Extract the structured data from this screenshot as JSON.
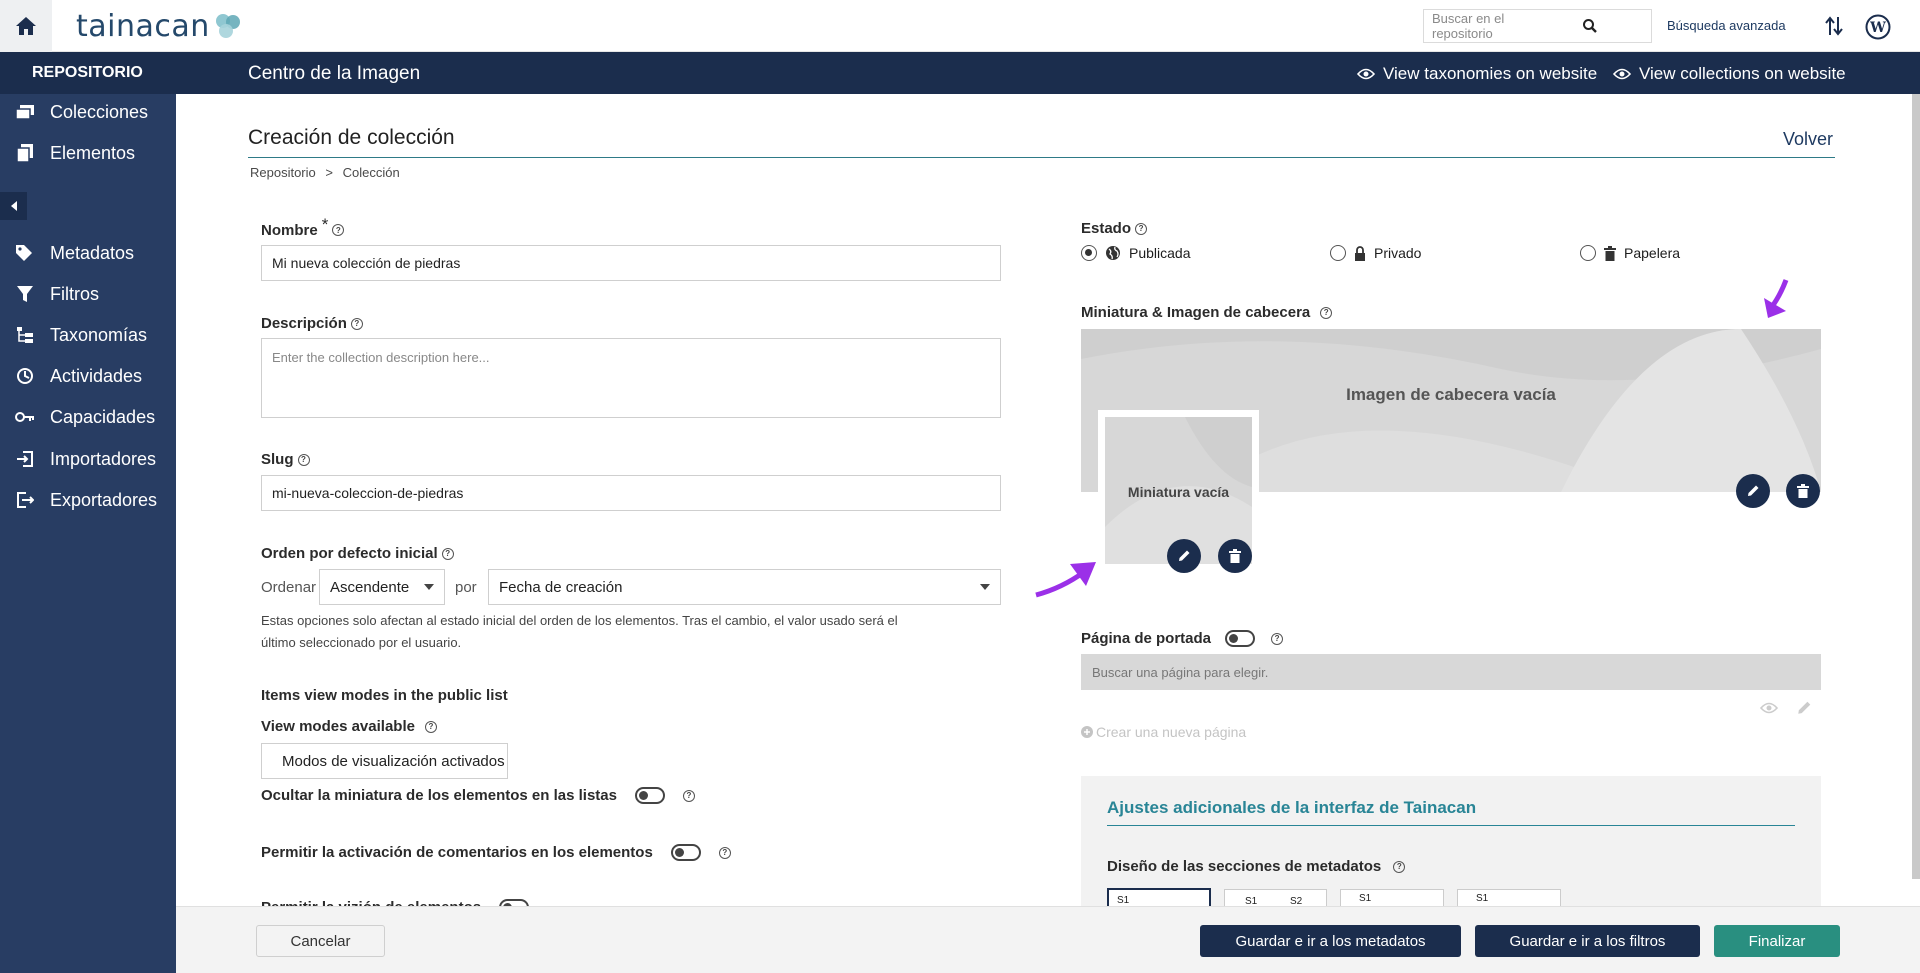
{
  "app": {
    "logo_text": "tainacan"
  },
  "topbar": {
    "search_placeholder": "Buscar en el repositorio",
    "advanced_search": "Búsqueda avanzada"
  },
  "sidebar": {
    "title": "REPOSITORIO",
    "items": [
      {
        "label": "Colecciones",
        "icon": "collections-icon"
      },
      {
        "label": "Elementos",
        "icon": "items-icon"
      },
      {
        "label": "Metadatos",
        "icon": "tag-icon"
      },
      {
        "label": "Filtros",
        "icon": "filter-icon"
      },
      {
        "label": "Taxonomías",
        "icon": "taxonomy-icon"
      },
      {
        "label": "Actividades",
        "icon": "activities-icon"
      },
      {
        "label": "Capacidades",
        "icon": "key-icon"
      },
      {
        "label": "Importadores",
        "icon": "import-icon"
      },
      {
        "label": "Exportadores",
        "icon": "export-icon"
      }
    ]
  },
  "header": {
    "repo_name": "Centro de la Imagen",
    "view_taxonomies": "View taxonomies on website",
    "view_collections": "View collections on website"
  },
  "page": {
    "title": "Creación de colección",
    "back": "Volver",
    "breadcrumb": {
      "root": "Repositorio",
      "sep": ">",
      "current": "Colección"
    }
  },
  "form": {
    "name_label": "Nombre",
    "name_required": "*",
    "name_value": "Mi nueva colección de piedras",
    "description_label": "Descripción",
    "description_placeholder": "Enter the collection description here...",
    "slug_label": "Slug",
    "slug_value": "mi-nueva-coleccion-de-piedras",
    "order_label": "Orden por defecto inicial",
    "order_prefix": "Ordenar",
    "order_value": "Ascendente",
    "order_by": "por",
    "order_field": "Fecha de creación",
    "order_note_1": "Estas opciones solo afectan al estado inicial del orden de los elementos. Tras el cambio, el valor usado será el",
    "order_note_2": "último seleccionado por el usuario.",
    "view_modes_section": "Items view modes in the public list",
    "view_modes_label": "View modes available",
    "view_modes_value": "Modos de visualización activados",
    "hide_thumbnail_label": "Ocultar la miniatura de los elementos en las listas",
    "comments_label": "Permitir la activación de comentarios en los elementos",
    "cut_label": "Permitir la vizión de elementos"
  },
  "status": {
    "label": "Estado",
    "options": [
      "Publicada",
      "Privado",
      "Papelera"
    ],
    "selected": "Publicada"
  },
  "images": {
    "label": "Miniatura & Imagen de cabecera",
    "header_empty": "Imagen de cabecera vacía",
    "thumbnail_empty": "Miniatura vacía"
  },
  "cover_page": {
    "label": "Página de portada",
    "search_placeholder": "Buscar una página para elegir.",
    "create_link": "Crear una nueva página"
  },
  "extra_settings": {
    "title": "Ajustes adicionales de la interfaz de Tainacan",
    "sections_design_label": "Diseño de las secciones de metadatos",
    "layout_options": [
      "S1",
      "S1 S2",
      "S1",
      "S1"
    ]
  },
  "footer": {
    "cancel": "Cancelar",
    "save_metadata": "Guardar e ir a los metadatos",
    "save_filters": "Guardar e ir a los filtros",
    "finish": "Finalizar"
  },
  "colors": {
    "navy": "#1b2d4d",
    "sidebar": "#283d63",
    "teal": "#298596",
    "annotation": "#9b30e8"
  }
}
